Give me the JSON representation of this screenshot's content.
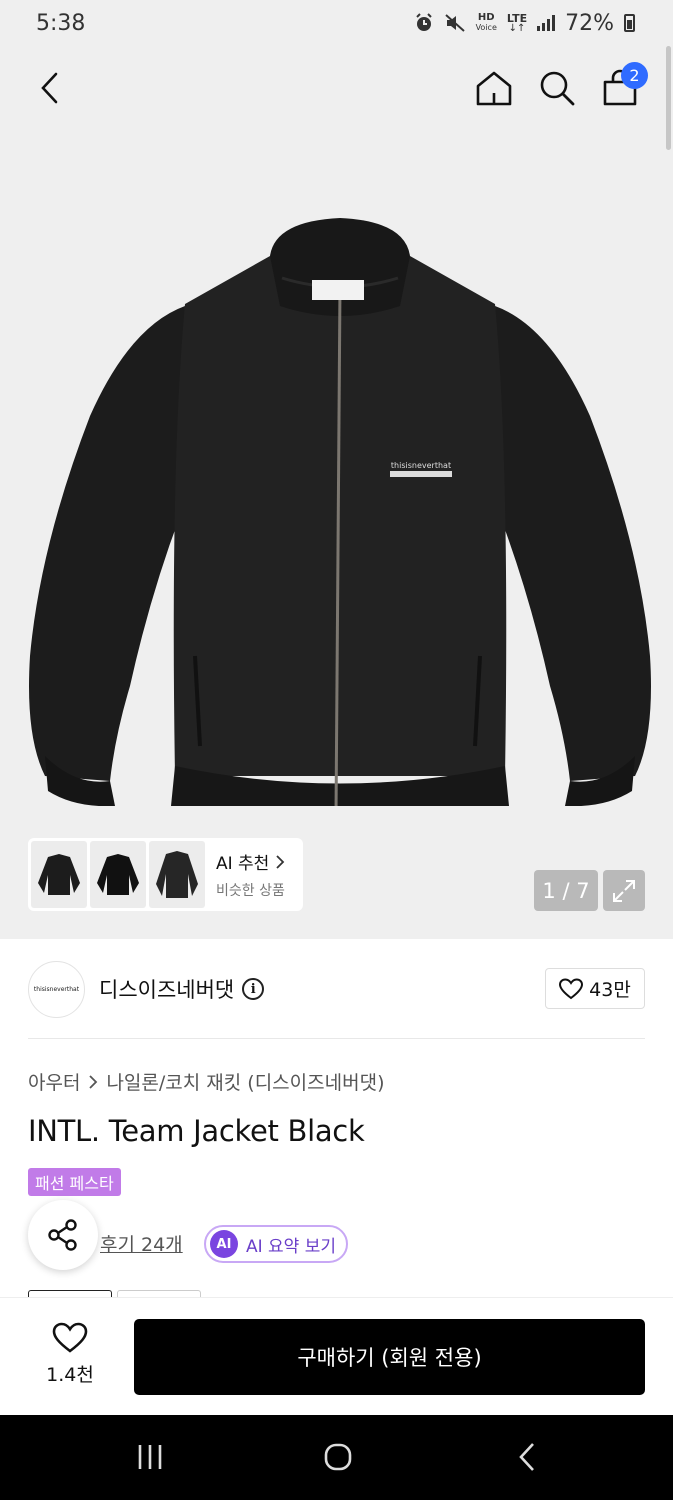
{
  "status_bar": {
    "time": "5:38",
    "battery_text": "72%",
    "hd_label": "HD",
    "voice_label": "Voice",
    "lte_label": "LTE",
    "icons": [
      "alarm-icon",
      "mute-icon",
      "signal-icon",
      "battery-icon"
    ]
  },
  "header": {
    "cart_count": "2"
  },
  "gallery": {
    "brand_print": "thisisneverthat",
    "ai_recommend_title": "AI 추천",
    "ai_recommend_sub": "비슷한 상품",
    "page_indicator": "1 / 7"
  },
  "brand": {
    "logo_text": "thisisneverthat",
    "name": "디스이즈네버댓",
    "info_symbol": "i",
    "like_count": "43만"
  },
  "breadcrumb": {
    "category": "아우터",
    "subcategory": "나일론/코치 재킷 (디스이즈네버댓)"
  },
  "product": {
    "title": "INTL. Team Jacket Black",
    "promo_tag": "패션 페스타",
    "review_link": "후기 24개",
    "ai_badge": "AI",
    "ai_summary": "AI 요약 보기"
  },
  "bottom_bar": {
    "wish_count": "1.4천",
    "buy_label": "구매하기 (회원 전용)"
  },
  "colors": {
    "accent_blue": "#2f6bff",
    "promo_purple": "#c17be8",
    "ai_purple": "#7a45e0",
    "buy_black": "#000000"
  }
}
